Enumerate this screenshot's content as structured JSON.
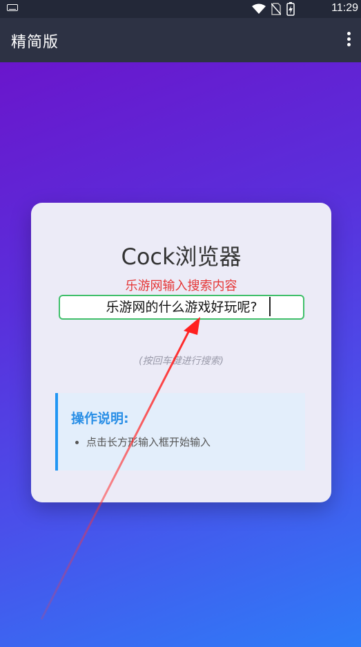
{
  "status_bar": {
    "time": "11:29",
    "icons": [
      "keyboard-icon",
      "wifi-icon",
      "no-sim-icon",
      "battery-charging-icon"
    ]
  },
  "app_bar": {
    "title": "精简版",
    "menu_icon": "more-vert-icon"
  },
  "card": {
    "brand": "Cock浏览器",
    "input_label": "乐游网输入搜索内容",
    "search_input": {
      "value": "乐游网的什么游戏好玩呢?",
      "placeholder": ""
    },
    "hint": "(按回车键进行搜索)",
    "help": {
      "title": "操作说明:",
      "items": [
        "点击长方形输入框开始输入"
      ]
    }
  },
  "colors": {
    "accent_red": "#e53535",
    "input_border": "#3fbf6a",
    "help_accent": "#2196f3"
  }
}
